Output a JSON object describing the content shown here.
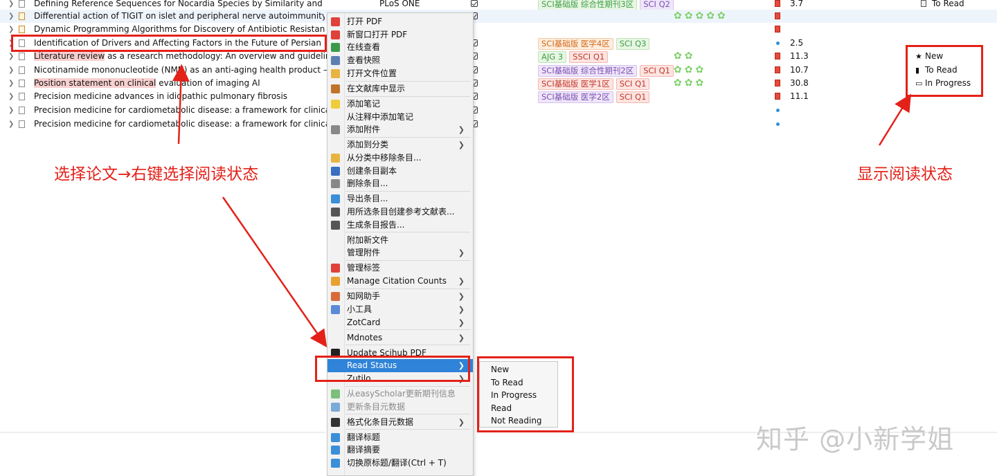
{
  "rows": [
    {
      "title": "Defining Reference Sequences for Nocardia Species by Similarity and Clustering Anal...",
      "pub": "PLoS ONE",
      "checked": true,
      "tags": [
        {
          "t": "SCI基础版 综合性期刊3区",
          "c": "green"
        },
        {
          "t": "SCI Q2",
          "c": "purple"
        }
      ],
      "clovers": "",
      "file": "pdf",
      "impact": "3.7",
      "read_status": "To Read"
    },
    {
      "title": "Differential action of TIGIT on islet and peripheral nerve autoimmunity in th...",
      "pub": "",
      "checked": true,
      "tags": [],
      "clovers": "✿✿✿✿✿",
      "file": "pdf",
      "impact": "",
      "read_status": ""
    },
    {
      "title": "Dynamic Programming Algorithms for Discovery of Antibiotic Resistance in...",
      "pub": "",
      "checked": false,
      "tags": [],
      "clovers": "",
      "file": "pdf",
      "impact": "",
      "read_status": ""
    },
    {
      "title": "Identification of Drivers and Affecting Factors in the Future of Persian Medi...",
      "pub": "",
      "checked": true,
      "tags": [
        {
          "t": "SCI基础版 医学4区",
          "c": "orange"
        },
        {
          "t": "SCI Q3",
          "c": "green"
        }
      ],
      "clovers": "",
      "file": "link",
      "impact": "2.5",
      "read_status": ""
    },
    {
      "title": "Literature review as a research methodology: An overview and guidelines",
      "pub": "",
      "checked": true,
      "tags": [
        {
          "t": "AJG 3",
          "c": "green"
        },
        {
          "t": "SSCI Q1",
          "c": "red"
        }
      ],
      "clovers": "✿✿",
      "file": "pdf",
      "impact": "11.3",
      "read_status": ""
    },
    {
      "title": "Nicotinamide mononucleotide (NMN) as an anti-aging health product – Pro...",
      "pub": "",
      "checked": true,
      "tags": [
        {
          "t": "SCI基础版 综合性期刊2区",
          "c": "purple"
        },
        {
          "t": "SCI Q1",
          "c": "red"
        }
      ],
      "clovers": "✿✿✿",
      "file": "pdf",
      "impact": "10.7",
      "read_status": ""
    },
    {
      "title": "Position statement on clinical evaluation of imaging AI",
      "pub": "",
      "checked": true,
      "tags": [
        {
          "t": "SCI基础版 医学1区",
          "c": "red"
        },
        {
          "t": "SCI Q1",
          "c": "red"
        }
      ],
      "clovers": "✿✿✿",
      "file": "pdf",
      "impact": "30.8",
      "read_status": ""
    },
    {
      "title": "Precision medicine advances in idiopathic pulmonary fibrosis",
      "pub": "",
      "checked": true,
      "tags": [
        {
          "t": "SCI基础版 医学2区",
          "c": "purple"
        },
        {
          "t": "SCI Q1",
          "c": "red"
        }
      ],
      "clovers": "",
      "file": "pdf",
      "impact": "11.1",
      "read_status": ""
    },
    {
      "title": "Precision medicine for cardiometabolic disease: a framework for clinical tran...",
      "pub": "",
      "checked": true,
      "tags": [],
      "clovers": "",
      "file": "link",
      "impact": "",
      "read_status": ""
    },
    {
      "title": "Precision medicine for cardiometabolic disease: a framework for clinical tran...",
      "pub": "",
      "checked": true,
      "tags": [],
      "clovers": "",
      "file": "link",
      "impact": "",
      "read_status": ""
    }
  ],
  "menu": [
    {
      "label": "打开 PDF",
      "icon": "pdf-icon",
      "color": "#e0413a"
    },
    {
      "label": "新窗口打开 PDF",
      "icon": "pdf-icon",
      "color": "#e0413a"
    },
    {
      "label": "在线查看",
      "icon": "globe-icon",
      "color": "#3b9a4a"
    },
    {
      "label": "查看快照",
      "icon": "snapshot-icon",
      "color": "#5a7fb0"
    },
    {
      "label": "打开文件位置",
      "icon": "folder-icon",
      "color": "#e8b441",
      "sep_after": true
    },
    {
      "label": "在文献库中显示",
      "icon": "library-icon",
      "color": "#c0742a",
      "sep_after": true
    },
    {
      "label": "添加笔记",
      "icon": "note-icon",
      "color": "#f0cc3a"
    },
    {
      "label": "从注释中添加笔记",
      "icon": "blank-icon",
      "color": ""
    },
    {
      "label": "添加附件",
      "icon": "paperclip-icon",
      "color": "#888888",
      "submenu": true,
      "sep_after": true
    },
    {
      "label": "添加到分类",
      "icon": "blank-icon",
      "color": "",
      "submenu": true
    },
    {
      "label": "从分类中移除条目...",
      "icon": "folder-remove-icon",
      "color": "#e8b441"
    },
    {
      "label": "创建条目副本",
      "icon": "duplicate-icon",
      "color": "#3a6fc0"
    },
    {
      "label": "删除条目...",
      "icon": "trash-icon",
      "color": "#888888",
      "sep_after": true
    },
    {
      "label": "导出条目...",
      "icon": "export-icon",
      "color": "#3a8fd8"
    },
    {
      "label": "用所选条目创建参考文献表...",
      "icon": "list-icon",
      "color": "#555555"
    },
    {
      "label": "生成条目报告...",
      "icon": "report-icon",
      "color": "#555555",
      "sep_after": true
    },
    {
      "label": "附加新文件",
      "icon": "blank-icon",
      "color": ""
    },
    {
      "label": "管理附件",
      "icon": "blank-icon",
      "color": "",
      "submenu": true,
      "sep_after": true
    },
    {
      "label": "管理标签",
      "icon": "tag-icon",
      "color": "#e0413a"
    },
    {
      "label": "Manage Citation Counts",
      "icon": "citation-icon",
      "color": "#e8a030",
      "submenu": true,
      "sep_after": true
    },
    {
      "label": "知网助手",
      "icon": "wrench-icon",
      "color": "#d86a3a",
      "submenu": true
    },
    {
      "label": "小工具",
      "icon": "wrench-icon",
      "color": "#5a8ad8",
      "submenu": true
    },
    {
      "label": "ZotCard",
      "icon": "blank-icon",
      "color": "",
      "submenu": true,
      "sep_after": true
    },
    {
      "label": "Mdnotes",
      "icon": "blank-icon",
      "color": "",
      "submenu": true,
      "sep_after": true
    },
    {
      "label": "Update Scihub PDF",
      "icon": "scihub-icon",
      "color": "#222222"
    },
    {
      "label": "Read Status",
      "icon": "blank-icon",
      "color": "",
      "submenu": true,
      "highlighted": true
    },
    {
      "label": "Zutilo",
      "icon": "blank-icon",
      "color": "",
      "submenu": true,
      "sep_after": true
    },
    {
      "label": "从easyScholar更新期刊信息",
      "icon": "update-icon",
      "color": "#7ac07a",
      "disabled": true
    },
    {
      "label": "更新条目元数据",
      "icon": "refresh-icon",
      "color": "#7aaad8",
      "disabled": true,
      "sep_after": true
    },
    {
      "label": "格式化条目元数据",
      "icon": "format-icon",
      "color": "#333333",
      "submenu": true,
      "sep_after": true
    },
    {
      "label": "翻译标题",
      "icon": "translate-icon",
      "color": "#3a8fd8"
    },
    {
      "label": "翻译摘要",
      "icon": "translate-icon",
      "color": "#3a8fd8"
    },
    {
      "label": "切换原标题/翻译(Ctrl + T)",
      "icon": "translate-icon",
      "color": "#3a8fd8"
    }
  ],
  "submenu": [
    "New",
    "To Read",
    "In Progress",
    "Read",
    "Not Reading"
  ],
  "legend": [
    {
      "label": "New",
      "icon": "star-icon"
    },
    {
      "label": "To Read",
      "icon": "book-closed-icon"
    },
    {
      "label": "In Progress",
      "icon": "book-open-icon"
    }
  ],
  "annotations": {
    "left_text": "选择论文→右键选择阅读状态",
    "right_text": "显示阅读状态",
    "watermark": "知乎 @小新学姐"
  },
  "colors": {
    "annotation_red": "#e32119",
    "highlight_blue": "#2f83d8",
    "clover_green": "#7ed16a"
  }
}
